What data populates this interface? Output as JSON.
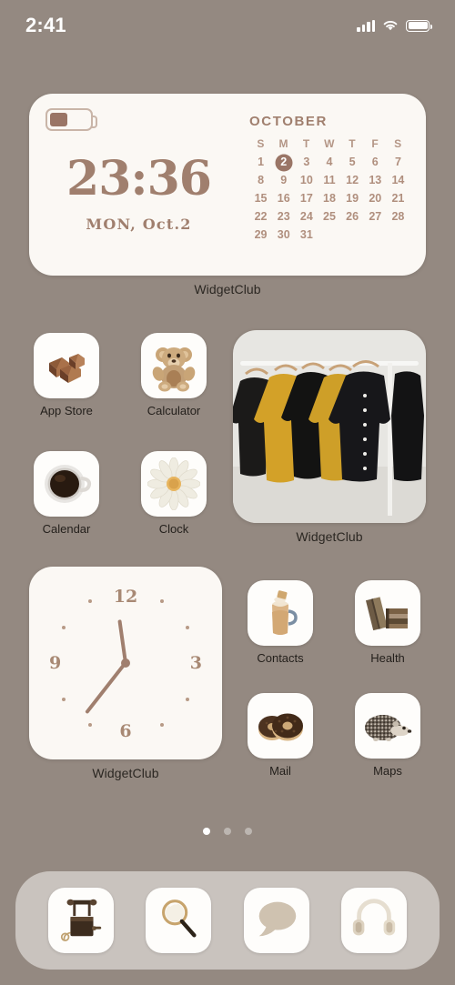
{
  "status_bar": {
    "time": "2:41",
    "signal_icon": "cellular-signal-icon",
    "wifi_icon": "wifi-icon",
    "battery_icon": "battery-icon"
  },
  "theme": {
    "wallpaper_color": "#948981",
    "widget_bg": "#fbf8f4",
    "accent_brown": "#a07f6e",
    "accent_dark": "#9a7566",
    "label_color": "#231f1b",
    "dock_bg": "#ded9d6"
  },
  "widgets": {
    "clock_calendar": {
      "label": "WidgetClub",
      "battery_level_percent": 45,
      "time": "23:36",
      "date": "MON, Oct.2",
      "calendar": {
        "month": "OCTOBER",
        "weekday_headers": [
          "S",
          "M",
          "T",
          "W",
          "T",
          "F",
          "S"
        ],
        "lead_blank_days": 0,
        "days": [
          1,
          2,
          3,
          4,
          5,
          6,
          7,
          8,
          9,
          10,
          11,
          12,
          13,
          14,
          15,
          16,
          17,
          18,
          19,
          20,
          21,
          22,
          23,
          24,
          25,
          26,
          27,
          28,
          29,
          30,
          31
        ],
        "highlighted_day": 2
      }
    },
    "photo": {
      "label": "WidgetClub",
      "description": "clothing rack with black and mustard shirts on hangers"
    },
    "analog_clock": {
      "label": "WidgetClub",
      "numerals": [
        "12",
        "3",
        "6",
        "9"
      ],
      "hour_hand_degrees": 352,
      "minute_hand_degrees": 218
    }
  },
  "apps": [
    {
      "label": "App Store",
      "icon": "chocolate-icon"
    },
    {
      "label": "Calculator",
      "icon": "teddy-bear-icon"
    },
    {
      "label": "Calendar",
      "icon": "coffee-cup-icon"
    },
    {
      "label": "Clock",
      "icon": "daisy-flower-icon"
    },
    {
      "label": "Contacts",
      "icon": "frappe-drink-icon"
    },
    {
      "label": "Health",
      "icon": "stacked-books-icon"
    },
    {
      "label": "Mail",
      "icon": "donuts-icon"
    },
    {
      "label": "Maps",
      "icon": "hedgehog-icon"
    }
  ],
  "page_indicator": {
    "total": 3,
    "active_index": 0
  },
  "dock": [
    {
      "name": "Phone",
      "icon": "vintage-telephone-icon"
    },
    {
      "name": "Safari",
      "icon": "magnifying-glass-icon"
    },
    {
      "name": "Messages",
      "icon": "speech-bubble-icon"
    },
    {
      "name": "Music",
      "icon": "headphones-icon"
    }
  ]
}
